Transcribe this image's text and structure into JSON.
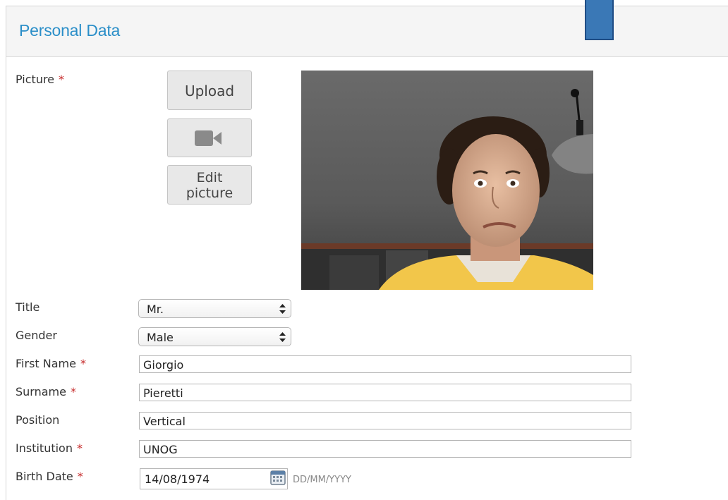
{
  "panel": {
    "title": "Personal Data"
  },
  "picture": {
    "label": "Picture",
    "required_mark": "*",
    "upload_label": "Upload",
    "camera_icon": "video-camera-icon",
    "edit_label_line1": "Edit",
    "edit_label_line2": "picture"
  },
  "form": {
    "title": {
      "label": "Title",
      "value": "Mr."
    },
    "gender": {
      "label": "Gender",
      "value": "Male"
    },
    "first_name": {
      "label": "First Name",
      "required": "*",
      "value": "Giorgio"
    },
    "surname": {
      "label": "Surname",
      "required": "*",
      "value": "Pieretti"
    },
    "position": {
      "label": "Position",
      "value": "Vertical"
    },
    "institution": {
      "label": "Institution",
      "required": "*",
      "value": "UNOG"
    },
    "birth_date": {
      "label": "Birth Date",
      "required": "*",
      "value": "14/08/1974",
      "format_hint": "DD/MM/YYYY"
    }
  },
  "colors": {
    "title_blue": "#2a8ec8",
    "required_red": "#c62828",
    "marker_blue": "#3a78b6"
  }
}
